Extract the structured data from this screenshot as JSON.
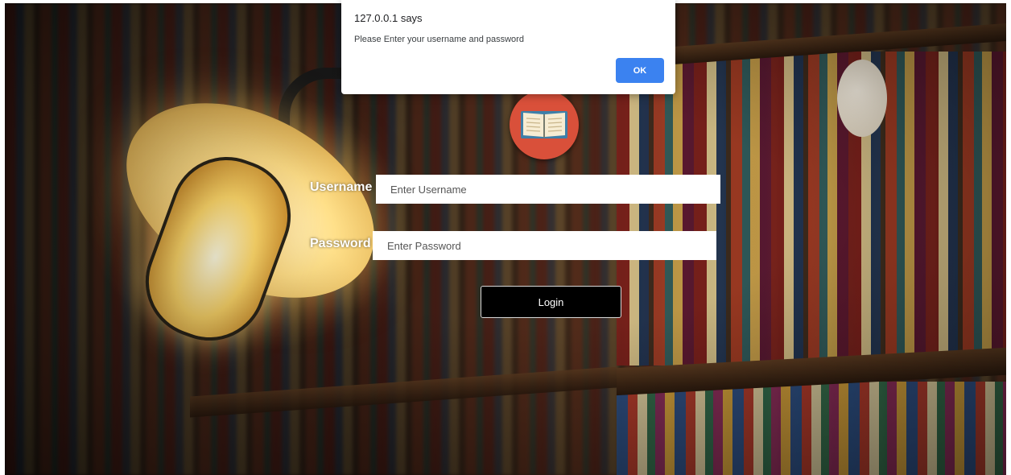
{
  "dialog": {
    "title": "127.0.0.1 says",
    "message": "Please Enter your username and password",
    "ok_label": "OK",
    "accent": "#3b82f0"
  },
  "logo": {
    "icon": "open-book-icon",
    "background": "#d9503a"
  },
  "form": {
    "username_label": "Username",
    "username_placeholder": "Enter Username",
    "username_value": "",
    "password_label": "Password",
    "password_placeholder": "Enter Password",
    "password_value": "",
    "login_label": "Login"
  },
  "background": {
    "scene": "library bookshelves with glowing caged lamp"
  }
}
